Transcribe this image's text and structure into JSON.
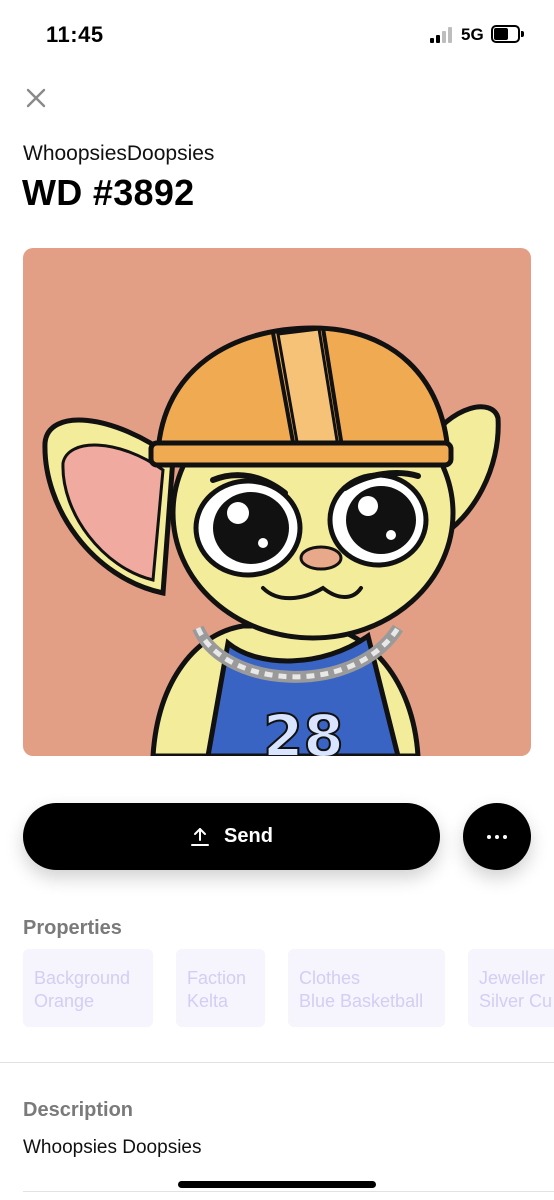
{
  "status_bar": {
    "time": "11:45",
    "network": "5G",
    "battery_level_fraction": 0.6
  },
  "header": {
    "close_icon": "close-icon",
    "collection_name": "WhoopsiesDoopsies",
    "token_title": "WD #3892"
  },
  "artwork": {
    "background_color": "#e39e86",
    "jersey_number": "28"
  },
  "actions": {
    "send_label": "Send",
    "send_icon": "upload-arrow-icon",
    "more_icon": "ellipsis-icon"
  },
  "properties": {
    "heading": "Properties",
    "items": [
      {
        "key": "Background",
        "value": "Orange"
      },
      {
        "key": "Faction",
        "value": "Kelta"
      },
      {
        "key": "Clothes",
        "value": "Blue Basketball"
      },
      {
        "key": "Jeweller",
        "value": "Silver Cu"
      }
    ]
  },
  "description": {
    "heading": "Description",
    "text": "Whoopsies Doopsies"
  },
  "colors": {
    "primary_button": "#000000",
    "chip_background": "#f6f4fd",
    "chip_text": "#d4cdf4",
    "section_heading": "#7a7a7a"
  }
}
